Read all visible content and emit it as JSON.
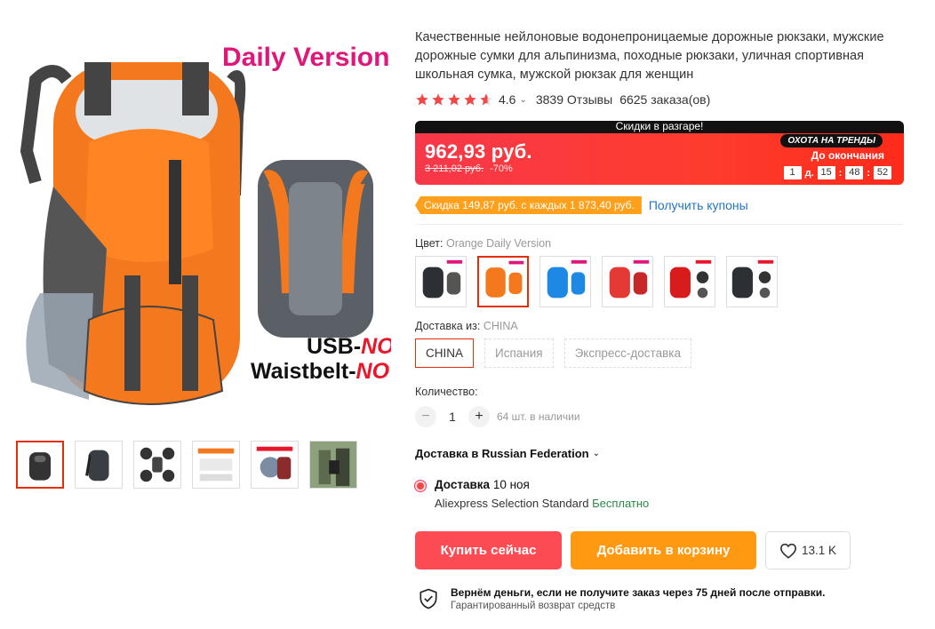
{
  "product": {
    "title": "Качественные нейлоновые водонепроницаемые дорожные рюкзаки, мужские дорожные сумки для альпинизма, походные рюкзаки, уличная спортивная школьная сумка, мужской рюкзак для женщин",
    "rating": "4.6",
    "stars_filled": 4.6,
    "reviews": "3839 Отзывы",
    "orders": "6625 заказа(ов)"
  },
  "gallery": {
    "brand_text": "Daily Version",
    "usb_line": "USB-",
    "usb_no": "NO",
    "waist_line": "Waistbelt-",
    "waist_no": "NO",
    "thumb_count": 6
  },
  "promo": {
    "header": "Скидки в разгаре!",
    "price": "962,93 руб.",
    "old_price": "3 211,02 руб.",
    "discount": "-70%",
    "trend_badge": "ОХОТА НА ТРЕНДЫ",
    "until_label": "До окончания",
    "timer": {
      "days": "1",
      "days_suffix": "д.",
      "hours": "15",
      "minutes": "48",
      "seconds": "52",
      "sep": ":"
    }
  },
  "coupon": {
    "text": "Скидка 149,87 руб. с каждых 1 873,40 руб.",
    "link": "Получить купоны"
  },
  "color": {
    "label": "Цвет:",
    "selected": "Orange Daily Version"
  },
  "shipping_from": {
    "label": "Доставка из:",
    "selected": "CHINA",
    "options": [
      "CHINA",
      "Испания",
      "Экспресс-доставка"
    ]
  },
  "quantity": {
    "label": "Количество:",
    "minus": "−",
    "value": "1",
    "plus": "+",
    "stock": "64 шт. в наличии"
  },
  "delivery": {
    "heading": "Доставка в Russian Federation",
    "title_bold": "Доставка",
    "date": "10 ноя",
    "service": "Aliexpress Selection Standard",
    "price": "Бесплатно"
  },
  "actions": {
    "buy": "Купить сейчас",
    "cart": "Добавить в корзину",
    "wishlist_count": "13.1 K"
  },
  "guarantee": {
    "title": "Вернём деньги, если не получите заказ через 75 дней после отправки.",
    "subtitle": "Гарантированный возврат средств"
  },
  "colors": {
    "accent_red": "#e62e04",
    "buy_button": "#fc4b53",
    "cart_button": "#ff9911",
    "coupon_orange": "#ffa01c",
    "link_blue": "#2375c9",
    "star": "#f04848"
  }
}
